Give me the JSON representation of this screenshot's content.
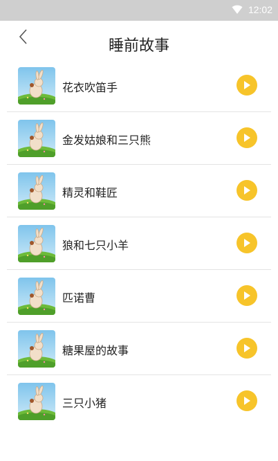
{
  "status_bar": {
    "time": "12:02",
    "wifi_icon": "wifi-icon"
  },
  "header": {
    "title": "睡前故事",
    "back_icon": "chevron-left-icon"
  },
  "colors": {
    "accent": "#f7c42a",
    "status_bar": "#cfcfcf",
    "divider": "#e3e3e3"
  },
  "stories": [
    {
      "title": "花衣吹笛手",
      "thumbnail_icon": "rabbit-illustration",
      "action_icon": "play-icon"
    },
    {
      "title": "金发姑娘和三只熊",
      "thumbnail_icon": "rabbit-illustration",
      "action_icon": "play-icon"
    },
    {
      "title": "精灵和鞋匠",
      "thumbnail_icon": "rabbit-illustration",
      "action_icon": "play-icon"
    },
    {
      "title": "狼和七只小羊",
      "thumbnail_icon": "rabbit-illustration",
      "action_icon": "play-icon"
    },
    {
      "title": "匹诺曹",
      "thumbnail_icon": "rabbit-illustration",
      "action_icon": "play-icon"
    },
    {
      "title": "糖果屋的故事",
      "thumbnail_icon": "rabbit-illustration",
      "action_icon": "play-icon"
    },
    {
      "title": "三只小猪",
      "thumbnail_icon": "rabbit-illustration",
      "action_icon": "play-icon"
    }
  ]
}
